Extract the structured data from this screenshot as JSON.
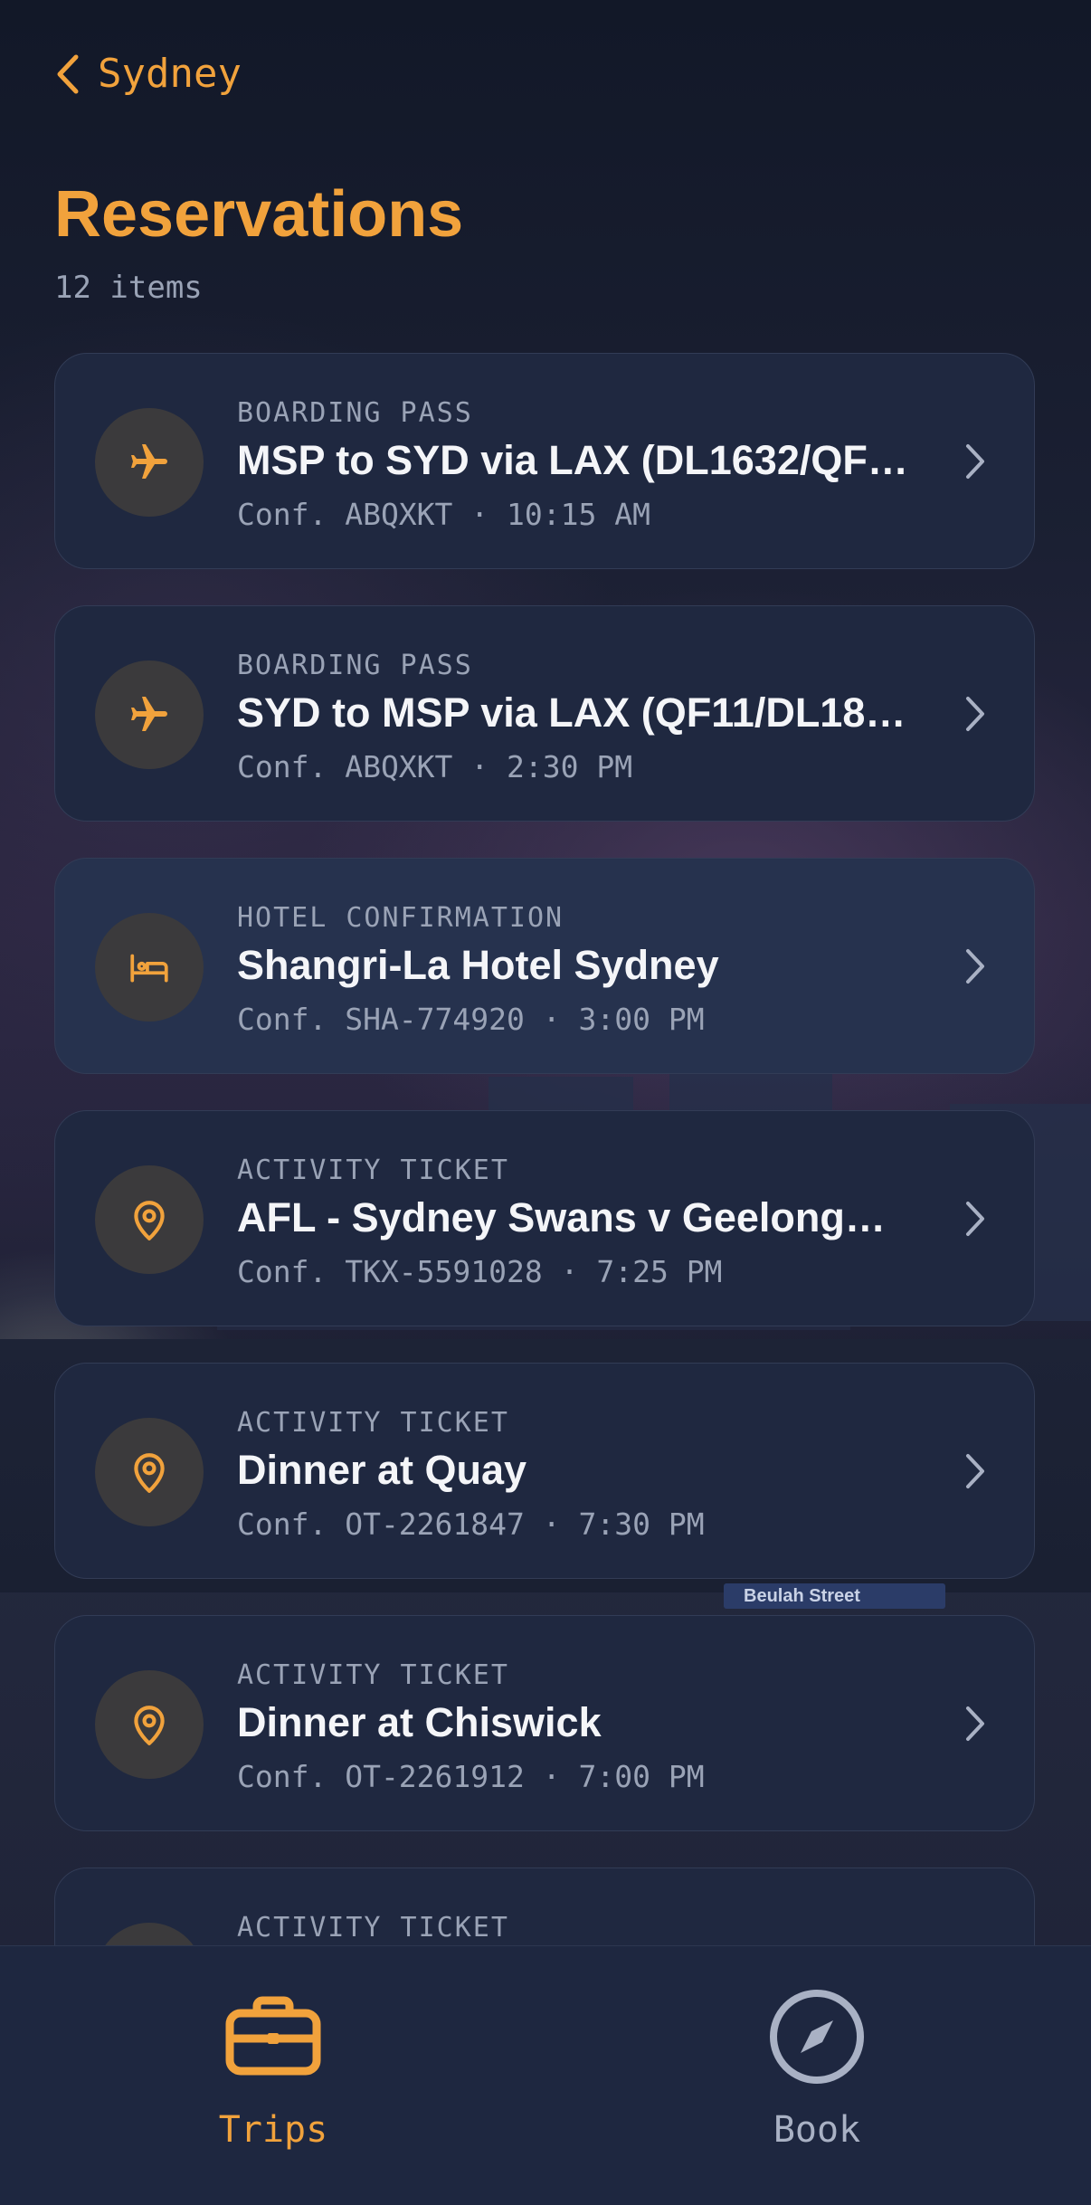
{
  "header": {
    "back_label": "Sydney",
    "title": "Reservations",
    "count": "12 items"
  },
  "reservations": [
    {
      "kind": "BOARDING PASS",
      "name": "MSP to SYD via LAX (DL1632/QF…",
      "meta": "Conf. ABQXKT · 10:15 AM",
      "icon": "plane-icon"
    },
    {
      "kind": "BOARDING PASS",
      "name": "SYD to MSP via LAX (QF11/DL18…",
      "meta": "Conf. ABQXKT · 2:30 PM",
      "icon": "plane-icon"
    },
    {
      "kind": "HOTEL CONFIRMATION",
      "name": "Shangri-La Hotel Sydney",
      "meta": "Conf. SHA-774920 · 3:00 PM",
      "icon": "bed-icon"
    },
    {
      "kind": "ACTIVITY TICKET",
      "name": "AFL - Sydney Swans v Geelong…",
      "meta": "Conf. TKX-5591028 · 7:25 PM",
      "icon": "location-pin-icon"
    },
    {
      "kind": "ACTIVITY TICKET",
      "name": "Dinner at Quay",
      "meta": "Conf. OT-2261847 · 7:30 PM",
      "icon": "location-pin-icon"
    },
    {
      "kind": "ACTIVITY TICKET",
      "name": "Dinner at Chiswick",
      "meta": "Conf. OT-2261912 · 7:00 PM",
      "icon": "location-pin-icon"
    },
    {
      "kind": "ACTIVITY TICKET",
      "name": "",
      "meta": "",
      "icon": "location-pin-icon"
    }
  ],
  "background_sign": "Beulah Street",
  "tabs": [
    {
      "label": "Trips",
      "icon": "briefcase-icon",
      "active": true
    },
    {
      "label": "Book",
      "icon": "compass-icon",
      "active": false
    }
  ],
  "colors": {
    "accent": "#f1a23c",
    "card": "#1f2840",
    "card_highlight": "#26324e",
    "text_primary": "#f4f5f8",
    "text_secondary": "#9aa3b6",
    "tab_inactive": "#a9b1c4"
  }
}
